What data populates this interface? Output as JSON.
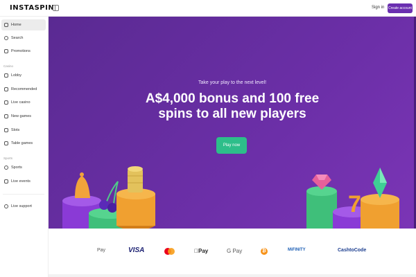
{
  "header": {
    "logo_text": "INSTASPIN",
    "sign_in": "Sign in",
    "create_account": "Create account"
  },
  "sidebar": {
    "top_items": [
      {
        "label": "Home",
        "icon": "home-icon"
      },
      {
        "label": "Search",
        "icon": "search-icon"
      },
      {
        "label": "Promotions",
        "icon": "promo-icon"
      }
    ],
    "sections": {
      "casino": "Casino",
      "sports": "Sports"
    },
    "casino_items": [
      {
        "label": "Lobby",
        "icon": "lobby-icon"
      },
      {
        "label": "Recommended",
        "icon": "star-icon"
      },
      {
        "label": "Live casino",
        "icon": "live-icon"
      },
      {
        "label": "New games",
        "icon": "new-icon"
      },
      {
        "label": "Slots",
        "icon": "slots-icon"
      },
      {
        "label": "Table games",
        "icon": "table-icon"
      }
    ],
    "sports_items": [
      {
        "label": "Sports",
        "icon": "ball-icon"
      },
      {
        "label": "Live events",
        "icon": "live-events-icon"
      }
    ],
    "support": {
      "label": "Live support",
      "icon": "chat-icon"
    }
  },
  "hero": {
    "tagline": "Take your play to the next level!",
    "headline_line1": "A$4,000 bonus and 100 free",
    "headline_line2": "spins to all new players",
    "cta": "Play now",
    "bg_color": "#6a2fa6",
    "cta_color": "#2dbe8a"
  },
  "payments": {
    "apay": "Pay",
    "visa": "VISA",
    "mastercard": "mastercard-icon",
    "applepay": "Pay",
    "googlepay": "G Pay",
    "bitcoin": "₿",
    "mifinity": "MiFINITY",
    "cashtocode": "CashtoCode"
  }
}
